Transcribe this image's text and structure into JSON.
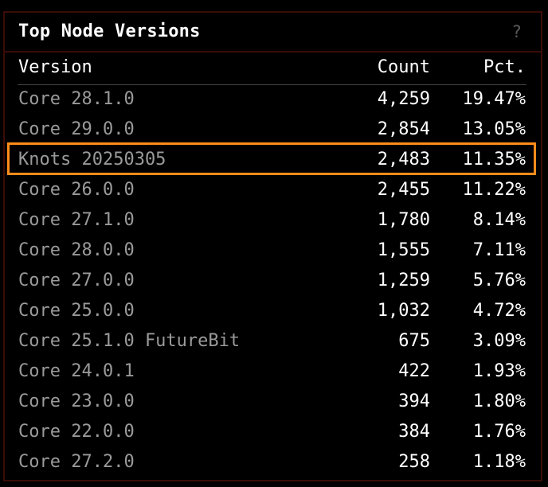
{
  "panel": {
    "title": "Top Node Versions",
    "help_label": "?"
  },
  "table": {
    "columns": {
      "version": "Version",
      "count": "Count",
      "pct": "Pct."
    },
    "rows": [
      {
        "version": "Core 28.1.0",
        "count": "4,259",
        "pct": "19.47%"
      },
      {
        "version": "Core 29.0.0",
        "count": "2,854",
        "pct": "13.05%"
      },
      {
        "version": "Knots 20250305",
        "count": "2,483",
        "pct": "11.35%",
        "highlighted": true
      },
      {
        "version": "Core 26.0.0",
        "count": "2,455",
        "pct": "11.22%"
      },
      {
        "version": "Core 27.1.0",
        "count": "1,780",
        "pct": "8.14%"
      },
      {
        "version": "Core 28.0.0",
        "count": "1,555",
        "pct": "7.11%"
      },
      {
        "version": "Core 27.0.0",
        "count": "1,259",
        "pct": "5.76%"
      },
      {
        "version": "Core 25.0.0",
        "count": "1,032",
        "pct": "4.72%"
      },
      {
        "version": "Core 25.1.0 FutureBit",
        "count": "675",
        "pct": "3.09%"
      },
      {
        "version": "Core 24.0.1",
        "count": "422",
        "pct": "1.93%"
      },
      {
        "version": "Core 23.0.0",
        "count": "394",
        "pct": "1.80%"
      },
      {
        "version": "Core 22.0.0",
        "count": "384",
        "pct": "1.76%"
      },
      {
        "version": "Core 27.2.0",
        "count": "258",
        "pct": "1.18%"
      }
    ]
  },
  "colors": {
    "background": "#000000",
    "panel_border": "#3a0c06",
    "highlight_border": "#ff8c1a",
    "version_text": "#9a9a9a",
    "value_text": "#ffffff"
  }
}
